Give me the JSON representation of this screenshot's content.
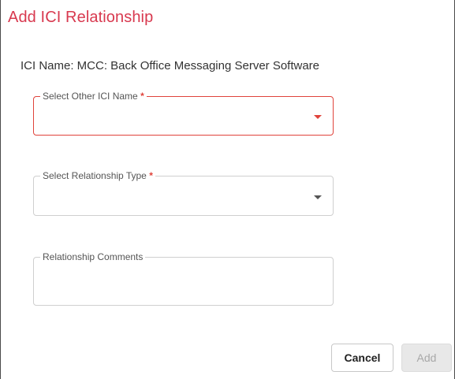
{
  "dialog": {
    "title": "Add ICI Relationship",
    "ici_name": "ICI Name: MCC: Back Office Messaging Server Software"
  },
  "fields": {
    "other_ici": {
      "label": "Select Other ICI Name",
      "required_mark": "*",
      "value": ""
    },
    "relationship_type": {
      "label": "Select Relationship Type",
      "required_mark": "*",
      "value": ""
    },
    "comments": {
      "label": "Relationship Comments",
      "value": ""
    }
  },
  "buttons": {
    "cancel_label": "Cancel",
    "add_label": "Add"
  },
  "colors": {
    "title": "#d8394f",
    "error_border": "#e0433b",
    "disabled_button": "#e8e8e8"
  },
  "icons": {
    "dropdown": "caret-down-icon"
  }
}
